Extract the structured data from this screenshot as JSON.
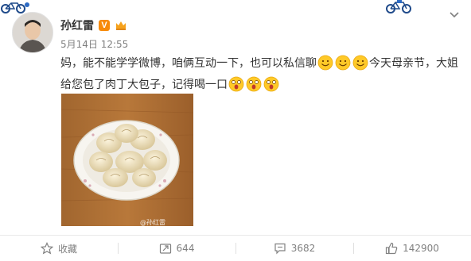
{
  "post": {
    "username": "孙红雷",
    "verified_badge": "V",
    "date": "5月14日 12:55",
    "text_part1": "妈，能不能学学微博，咱俩互动一下，也可以私信聊",
    "text_part2": "今天母亲节，大姐给您包了肉丁大包子，记得喝一口",
    "photo_watermark": "@孙红雷",
    "icons": {
      "menu": "chevron-down-icon",
      "smile_emoji": "smile-emoji-icon",
      "shocked_emoji": "shocked-emoji-icon"
    }
  },
  "actions": {
    "favorite_label": "收藏",
    "repost_count": "644",
    "comment_count": "3682",
    "like_count": "142900"
  },
  "colors": {
    "accent": "#f78a09",
    "text": "#333333",
    "muted": "#808080",
    "emoji_yellow": "#ffc928"
  }
}
